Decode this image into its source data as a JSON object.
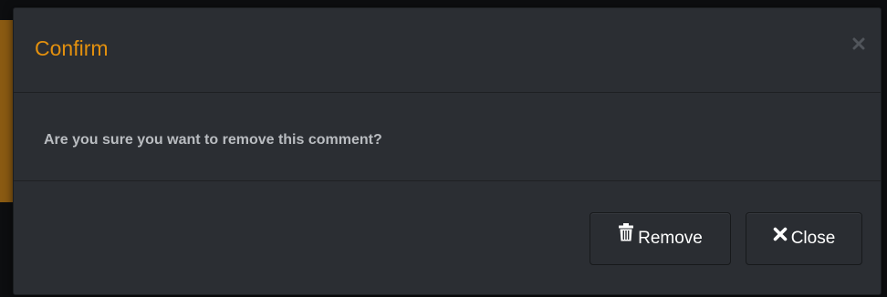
{
  "dialog": {
    "title": "Confirm",
    "close_icon": "close-x-icon",
    "message": "Are you sure you want to remove this comment?",
    "buttons": {
      "remove": {
        "label": "Remove",
        "icon": "trash-icon"
      },
      "close": {
        "label": "Close",
        "icon": "times-icon"
      }
    }
  },
  "colors": {
    "title": "#e3900e",
    "background": "#2b2e33",
    "text": "#b9bcc0",
    "button_text": "#ffffff"
  }
}
